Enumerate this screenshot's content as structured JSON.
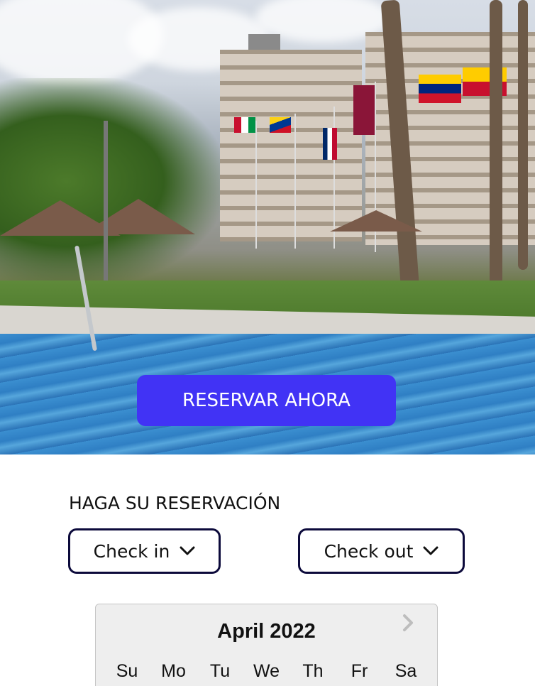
{
  "hero": {
    "image_alt": "hotel-pool-photo",
    "cta_label": "RESERVAR AHORA",
    "cta_color": "#4133f5"
  },
  "booking": {
    "title": "HAGA SU RESERVACIÓN",
    "check_in_label": "Check in",
    "check_out_label": "Check out",
    "border_color": "#0c0a3b"
  },
  "calendar": {
    "month_label": "April 2022",
    "next_icon": "chevron-right-icon",
    "weekdays": [
      "Su",
      "Mo",
      "Tu",
      "We",
      "Th",
      "Fr",
      "Sa"
    ]
  }
}
